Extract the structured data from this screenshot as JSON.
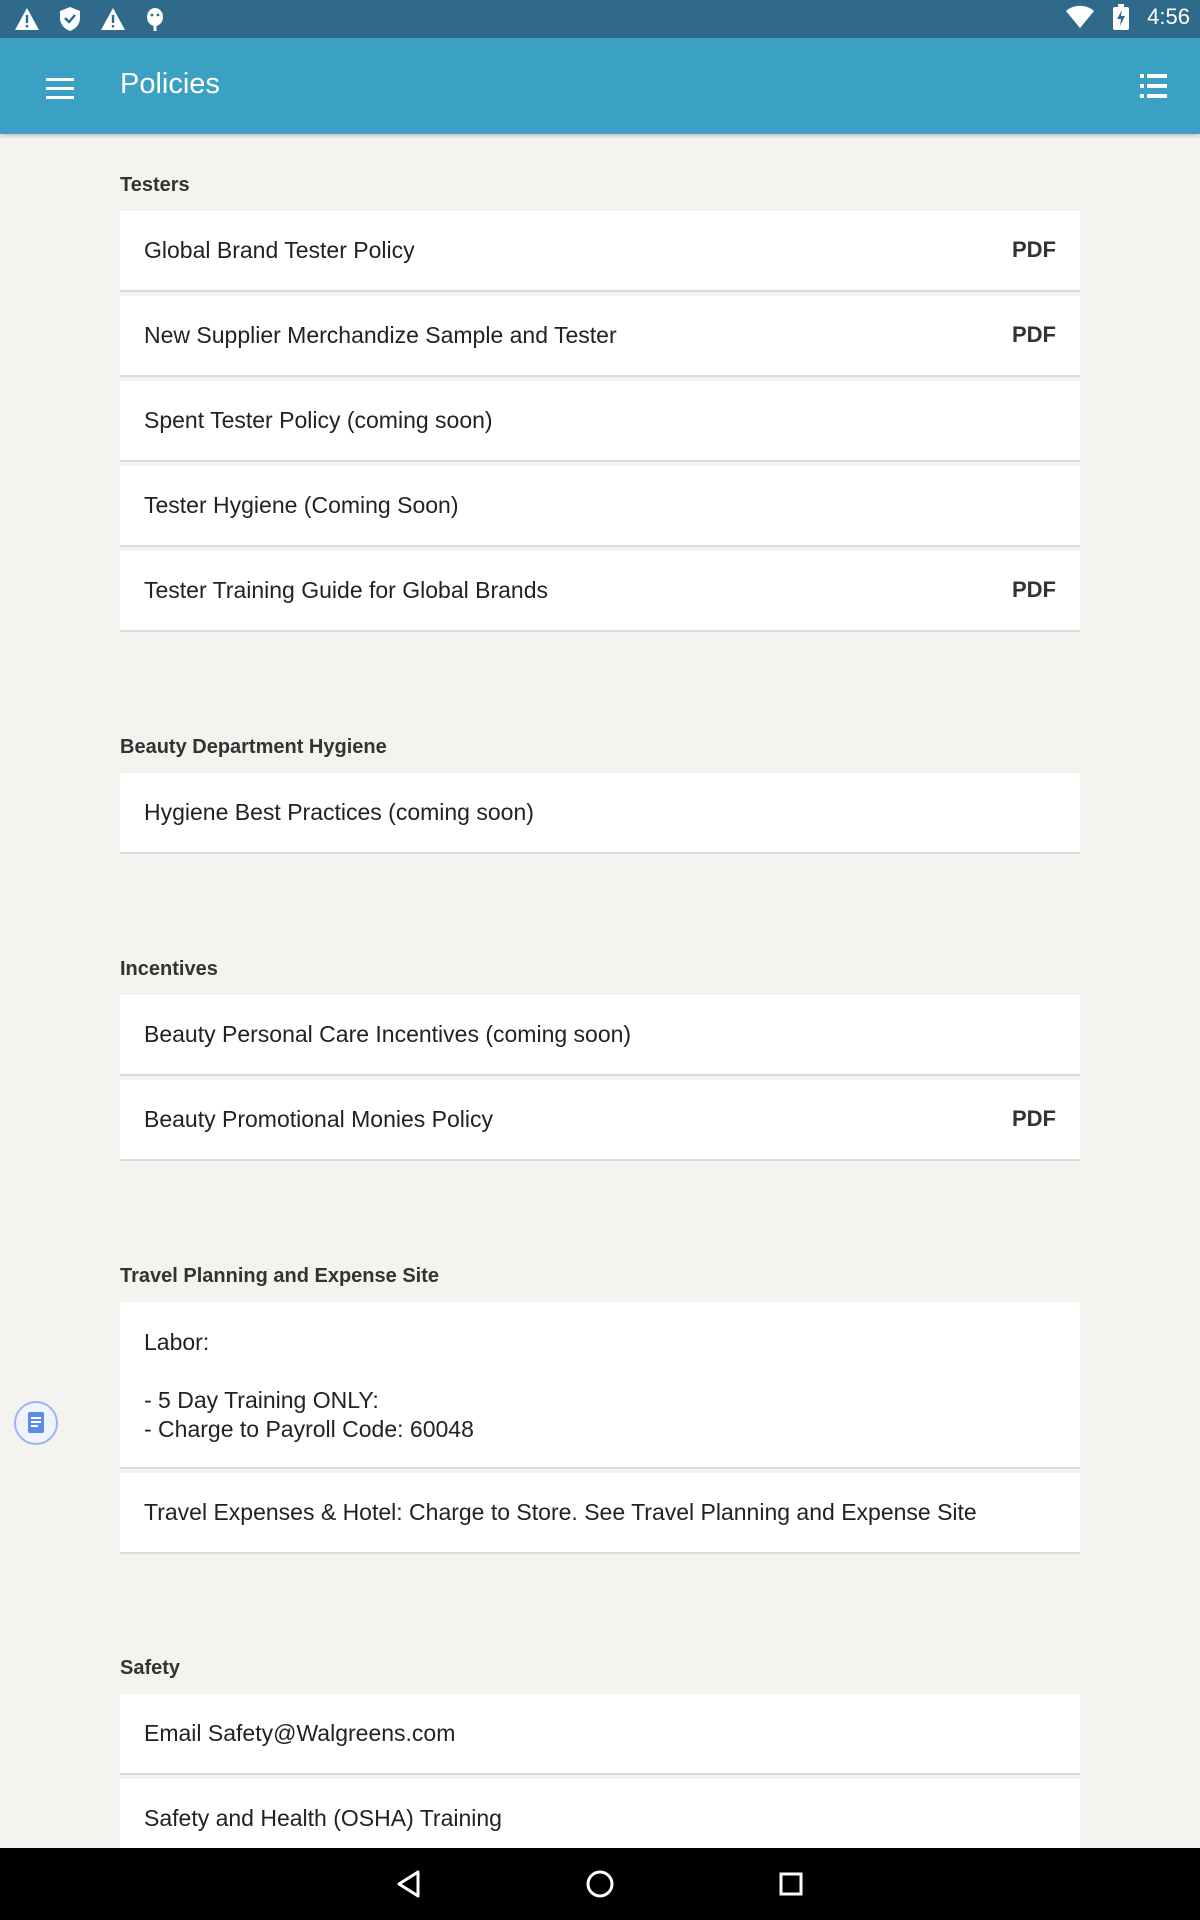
{
  "status_bar": {
    "time": "4:56",
    "icons": [
      "warning-icon",
      "shield-icon",
      "warning-icon",
      "android-debug-icon",
      "wifi-icon",
      "battery-charging-icon"
    ]
  },
  "app_bar": {
    "title": "Policies",
    "left_icon": "hamburger-menu-icon",
    "right_icon": "list-view-icon"
  },
  "sections": [
    {
      "title": "Testers",
      "items": [
        {
          "label": "Global Brand Tester Policy",
          "badge": "PDF"
        },
        {
          "label": "New Supplier Merchandize Sample and Tester",
          "badge": "PDF"
        },
        {
          "label": "Spent Tester Policy (coming soon)",
          "badge": ""
        },
        {
          "label": "Tester Hygiene (Coming Soon)",
          "badge": ""
        },
        {
          "label": "Tester Training Guide for Global Brands",
          "badge": "PDF"
        }
      ]
    },
    {
      "title": "Beauty Department Hygiene",
      "items": [
        {
          "label": "Hygiene Best Practices (coming soon)",
          "badge": ""
        }
      ]
    },
    {
      "title": "Incentives",
      "items": [
        {
          "label": "Beauty Personal Care Incentives (coming soon)",
          "badge": ""
        },
        {
          "label": "Beauty Promotional Monies Policy",
          "badge": "PDF"
        }
      ]
    },
    {
      "title": "Travel Planning and Expense Site",
      "items": [
        {
          "label": "Labor:\n\n- 5 Day Training ONLY:\n- Charge to Payroll Code: 60048",
          "badge": ""
        },
        {
          "label": "Travel Expenses & Hotel: Charge to Store. See Travel Planning and Expense Site",
          "badge": ""
        }
      ]
    },
    {
      "title": "Safety",
      "items": [
        {
          "label": "Email Safety@Walgreens.com",
          "badge": ""
        },
        {
          "label": "Safety and Health (OSHA) Training",
          "badge": ""
        }
      ]
    }
  ],
  "floating_button": {
    "icon": "document-icon"
  },
  "nav_bar": {
    "icons": [
      "back-icon",
      "home-icon",
      "recents-icon"
    ]
  },
  "colors": {
    "status_bar": "#2f6a8a",
    "app_bar": "#3aa0c4",
    "background": "#f5f3ef",
    "card": "#ffffff"
  }
}
